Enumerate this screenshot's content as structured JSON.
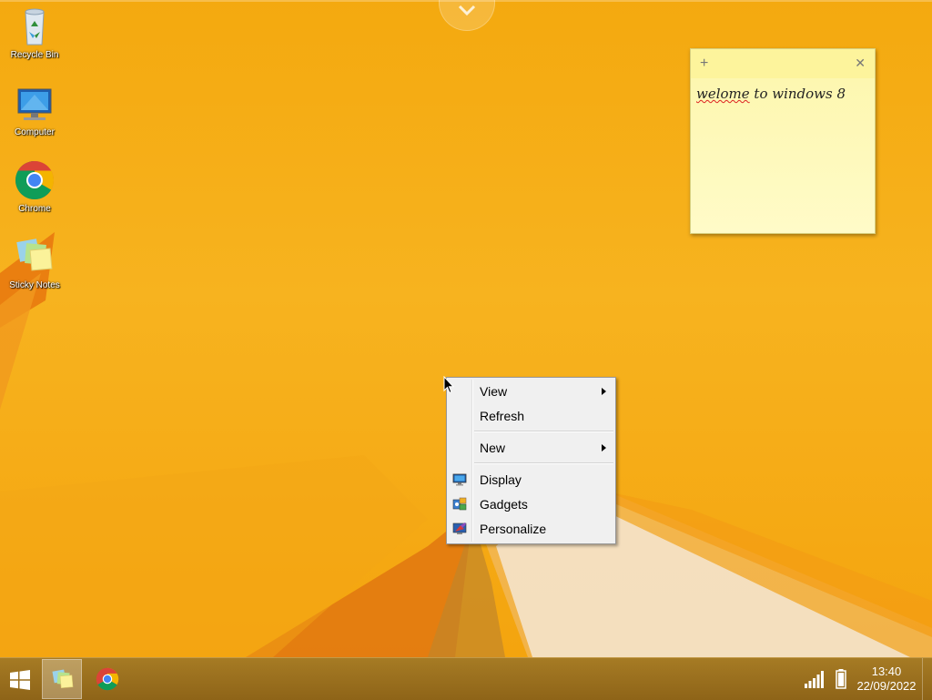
{
  "desktop": {
    "icons": [
      {
        "label": "Recycle Bin",
        "icon": "recycle-bin-icon"
      },
      {
        "label": "Computer",
        "icon": "computer-icon"
      },
      {
        "label": "Chrome",
        "icon": "chrome-icon"
      },
      {
        "label": "Sticky Notes",
        "icon": "sticky-notes-icon"
      }
    ]
  },
  "sticky_note": {
    "add": "+",
    "close": "✕",
    "text_misspelled": "welome",
    "text_rest": " to windows 8"
  },
  "context_menu": {
    "view": "View",
    "refresh": "Refresh",
    "new": "New",
    "display": "Display",
    "gadgets": "Gadgets",
    "personalize": "Personalize"
  },
  "taskbar": {
    "apps": [
      {
        "name": "Sticky Notes",
        "icon": "sticky-notes-icon",
        "active": true
      },
      {
        "name": "Chrome",
        "icon": "chrome-icon",
        "active": false
      }
    ],
    "time": "13:40",
    "date": "22/09/2022"
  },
  "colors": {
    "wallpaper": "#f7b21a",
    "taskbar": "#9a701e",
    "sticky": "#fdf9a8"
  }
}
